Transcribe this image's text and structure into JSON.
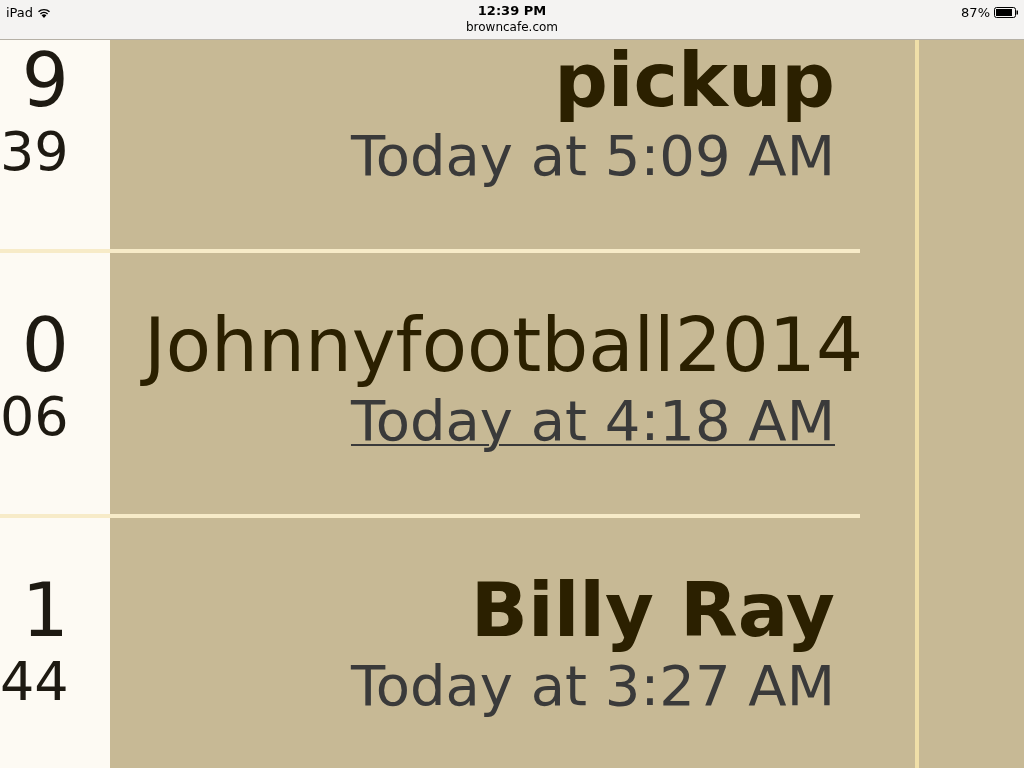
{
  "status_bar": {
    "device": "iPad",
    "time": "12:39 PM",
    "url": "browncafe.com",
    "battery": "87%"
  },
  "threads": [
    {
      "stats": [
        "9",
        "39"
      ],
      "title": "pickup",
      "unread": true,
      "time": "Today at 5:09 AM",
      "time_underlined": false
    },
    {
      "stats": [
        "0",
        "06"
      ],
      "title": "Johnnyfootball2014",
      "unread": false,
      "time": "Today at 4:18 AM",
      "time_underlined": true
    },
    {
      "stats": [
        "1",
        "44"
      ],
      "title": "Billy Ray",
      "unread": true,
      "time": "Today at 3:27 AM",
      "time_underlined": false
    }
  ]
}
